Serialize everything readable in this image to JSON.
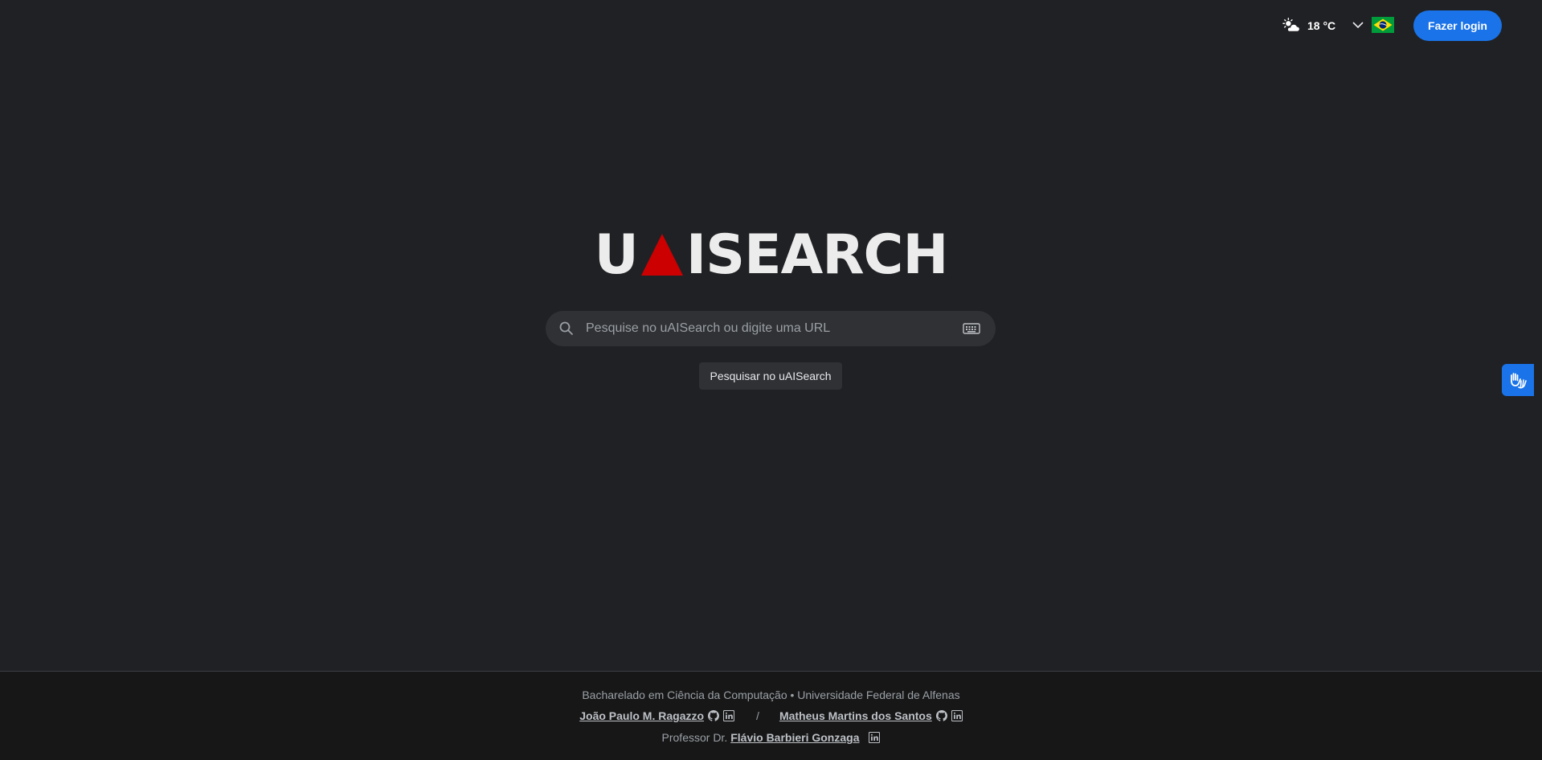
{
  "header": {
    "weather": {
      "icon": "partly-cloudy-icon",
      "temperature": "18 °C"
    },
    "language": {
      "icon": "chevron-down-icon",
      "flag": "brazil-flag"
    },
    "login_label": "Fazer login"
  },
  "logo": {
    "part1": "U",
    "part2": "ISEARCH",
    "triangle_color": "#cc0000"
  },
  "search": {
    "placeholder": "Pesquise no uAISearch ou digite uma URL",
    "button_label": "Pesquisar no uAISearch"
  },
  "accessibility": {
    "icon": "sign-language-hands-icon"
  },
  "footer": {
    "line1": "Bacharelado em Ciência da Computação • Universidade Federal de Alfenas",
    "author1": "João Paulo M. Ragazzo",
    "separator": "/",
    "author2": "Matheus Martins dos Santos",
    "professor_prefix": "Professor Dr.",
    "professor": "Flávio Barbieri Gonzaga"
  },
  "colors": {
    "background": "#202124",
    "accent": "#1a73e8",
    "footer_bg": "#171717",
    "logo_text": "#ececec"
  }
}
